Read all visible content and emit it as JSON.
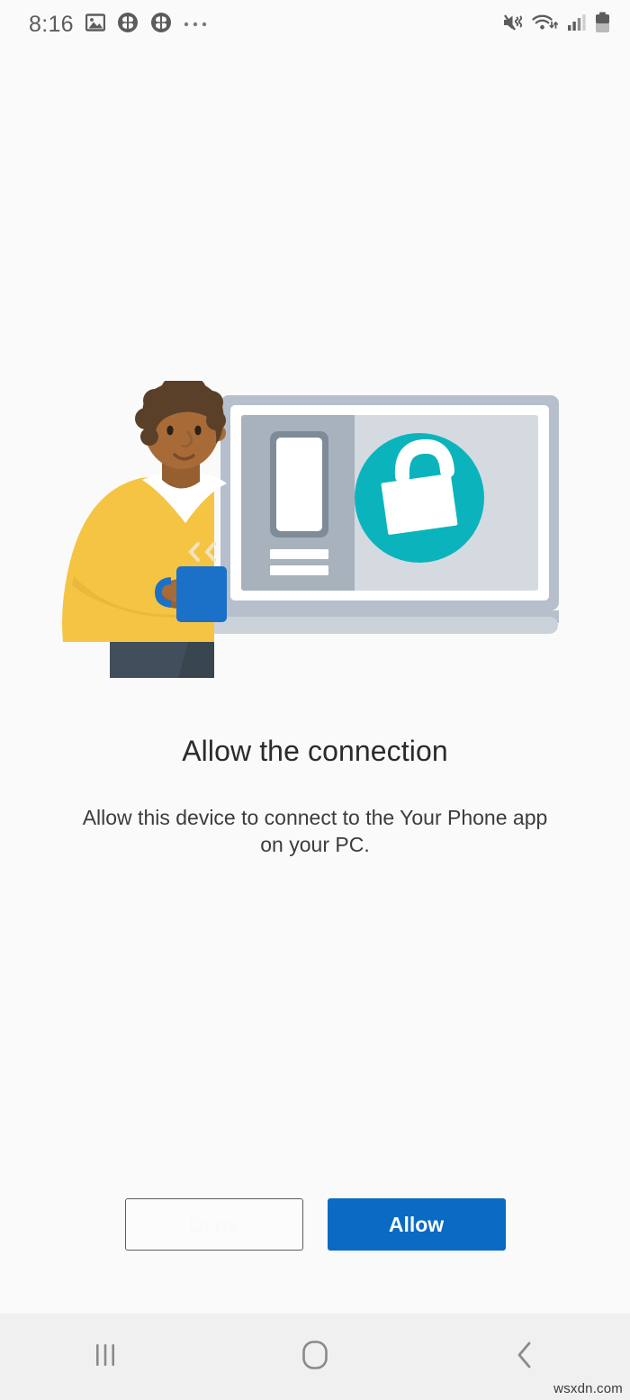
{
  "status_bar": {
    "clock": "8:16",
    "left_icons": [
      {
        "name": "image-icon",
        "label": "image"
      },
      {
        "name": "clover-app-icon-1",
        "label": "clover"
      },
      {
        "name": "clover-app-icon-2",
        "label": "clover"
      },
      {
        "name": "more-notifications-icon",
        "label": "···"
      }
    ],
    "right_icons": [
      {
        "name": "mute-vibrate-icon",
        "label": "sound off"
      },
      {
        "name": "wifi-icon",
        "label": "wifi"
      },
      {
        "name": "signal-bars-icon",
        "label": "signal"
      },
      {
        "name": "battery-icon",
        "label": "battery"
      }
    ]
  },
  "illustration": {
    "name": "allow-connection-illustration",
    "alt": "Person holding a coffee mug next to a laptop showing a phone and an unlocked padlock",
    "colors": {
      "sweater": "#f5c443",
      "sweater_shadow": "#eab93b",
      "skin": "#a86b38",
      "skin_shadow": "#965f30",
      "hair": "#5a4028",
      "shirt": "#ffffff",
      "pants": "#414f5c",
      "mug": "#1b70c8",
      "laptop_frame": "#b6bfcb",
      "laptop_inner": "#ffffff",
      "laptop_screen": "#d5dae1",
      "phone_panel": "#a8b2bd",
      "phone_bezel": "#7e8b99",
      "teal": "#0bb4bc",
      "lock": "#ffffff"
    }
  },
  "main": {
    "headline": "Allow the connection",
    "subtext": "Allow this device to connect to the Your Phone app on your PC."
  },
  "actions": {
    "deny_label": "Deny",
    "allow_label": "Allow",
    "allow_color": "#0a6ac4",
    "deny_border_color": "#5c5c5c"
  },
  "nav_bar": {
    "recents_label": "Recents",
    "home_label": "Home",
    "back_label": "Back"
  },
  "watermark": {
    "text": "wsxdn.com"
  }
}
